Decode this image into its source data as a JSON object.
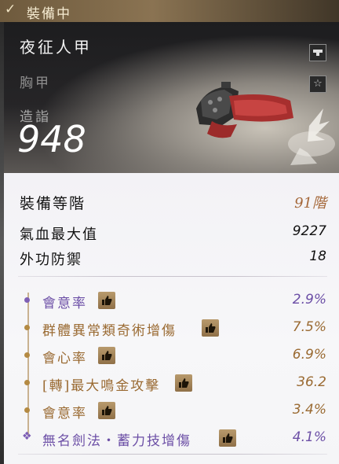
{
  "header": {
    "equipped_label": "裝備中",
    "item_name": "夜征人甲",
    "item_slot": "胸甲",
    "score_label": "造詣",
    "score_value": "948"
  },
  "icons": {
    "equipped": "check-icon",
    "lock": "lock-icon",
    "favorite": "star-icon",
    "recommend": "thumbs-up-icon",
    "item": "armor-icon",
    "emblem": "bird-emblem-icon"
  },
  "base_stats": {
    "tier_label": "裝備等階",
    "tier_value": "91階",
    "hp_label": "氣血最大值",
    "hp_value": "9227",
    "def_label": "外功防禦",
    "def_value": "18"
  },
  "sub_stats": [
    {
      "name": "會意率",
      "value": "2.9%",
      "color": "purple"
    },
    {
      "name": "群體異常類奇術增傷",
      "value": "7.5%",
      "color": "gold"
    },
    {
      "name": "會心率",
      "value": "6.9%",
      "color": "gold"
    },
    {
      "name": "[轉]最大鳴金攻擊",
      "value": "36.2",
      "color": "gold"
    },
    {
      "name": "會意率",
      "value": "3.4%",
      "color": "gold"
    },
    {
      "name": "無名劍法・蓄力技增傷",
      "value": "4.1%",
      "color": "purple"
    }
  ],
  "colors": {
    "gold": "#9a6a32",
    "purple": "#6c4fa6",
    "tier": "#a5683a"
  }
}
